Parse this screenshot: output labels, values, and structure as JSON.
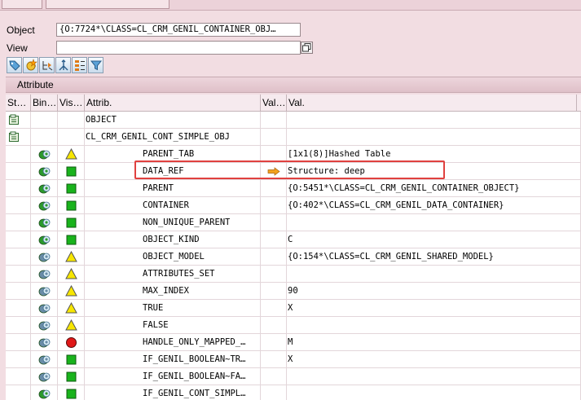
{
  "form": {
    "object_label": "Object",
    "object_value": "{O:7724*\\CLASS=CL_CRM_GENIL_CONTAINER_OBJ…",
    "view_label": "View",
    "view_value": ""
  },
  "toolbar": {
    "buttons": [
      "tag-icon",
      "star-icon",
      "hierarchy-icon",
      "split-icon",
      "list-icon",
      "filter-icon"
    ]
  },
  "panel": {
    "title": "Attribute"
  },
  "columns": [
    "St…",
    "Bin…",
    "Vis…",
    "Attrib.",
    "Val…",
    "Val."
  ],
  "rows": [
    {
      "status": "folder",
      "bind": "",
      "vis": "",
      "attr": "OBJECT",
      "level": 0,
      "arrow": false,
      "value": ""
    },
    {
      "status": "folder",
      "bind": "",
      "vis": "",
      "attr": "CL_CRM_GENIL_CONT_SIMPLE_OBJ",
      "level": 0,
      "arrow": false,
      "value": ""
    },
    {
      "status": "",
      "bind": "green",
      "vis": "triangle",
      "attr": "PARENT_TAB",
      "level": 1,
      "arrow": false,
      "value": "[1x1(8)]Hashed Table"
    },
    {
      "status": "",
      "bind": "green",
      "vis": "square",
      "attr": "DATA_REF",
      "level": 1,
      "arrow": true,
      "value": "Structure: deep"
    },
    {
      "status": "",
      "bind": "green",
      "vis": "square",
      "attr": "PARENT",
      "level": 1,
      "arrow": false,
      "value": "{O:5451*\\CLASS=CL_CRM_GENIL_CONTAINER_OBJECT}"
    },
    {
      "status": "",
      "bind": "green",
      "vis": "square",
      "attr": "CONTAINER",
      "level": 1,
      "arrow": false,
      "value": "{O:402*\\CLASS=CL_CRM_GENIL_DATA_CONTAINER}"
    },
    {
      "status": "",
      "bind": "green",
      "vis": "square",
      "attr": "NON_UNIQUE_PARENT",
      "level": 1,
      "arrow": false,
      "value": ""
    },
    {
      "status": "",
      "bind": "green",
      "vis": "square",
      "attr": "OBJECT_KIND",
      "level": 1,
      "arrow": false,
      "value": "C"
    },
    {
      "status": "",
      "bind": "grey",
      "vis": "triangle",
      "attr": "OBJECT_MODEL",
      "level": 1,
      "arrow": false,
      "value": "{O:154*\\CLASS=CL_CRM_GENIL_SHARED_MODEL}"
    },
    {
      "status": "",
      "bind": "grey",
      "vis": "triangle",
      "attr": "ATTRIBUTES_SET",
      "level": 1,
      "arrow": false,
      "value": ""
    },
    {
      "status": "",
      "bind": "grey",
      "vis": "triangle",
      "attr": "MAX_INDEX",
      "level": 1,
      "arrow": false,
      "value": "90"
    },
    {
      "status": "",
      "bind": "grey",
      "vis": "triangle",
      "attr": "TRUE",
      "level": 1,
      "arrow": false,
      "value": "X"
    },
    {
      "status": "",
      "bind": "grey",
      "vis": "triangle",
      "attr": "FALSE",
      "level": 1,
      "arrow": false,
      "value": ""
    },
    {
      "status": "",
      "bind": "grey",
      "vis": "circle",
      "attr": "HANDLE_ONLY_MAPPED_…",
      "level": 1,
      "arrow": false,
      "value": "M"
    },
    {
      "status": "",
      "bind": "grey",
      "vis": "square",
      "attr": "IF_GENIL_BOOLEAN~TR…",
      "level": 1,
      "arrow": false,
      "value": "X"
    },
    {
      "status": "",
      "bind": "grey",
      "vis": "square",
      "attr": "IF_GENIL_BOOLEAN~FA…",
      "level": 1,
      "arrow": false,
      "value": ""
    },
    {
      "status": "",
      "bind": "green",
      "vis": "square",
      "attr": "IF_GENIL_CONT_SIMPL…",
      "level": 1,
      "arrow": false,
      "value": ""
    }
  ],
  "colors": {
    "background": "#f2dde2",
    "highlight": "#e0413f",
    "ok_square": "#19b31c",
    "warning_triangle": "#f7e600",
    "error_circle": "#e01818"
  }
}
